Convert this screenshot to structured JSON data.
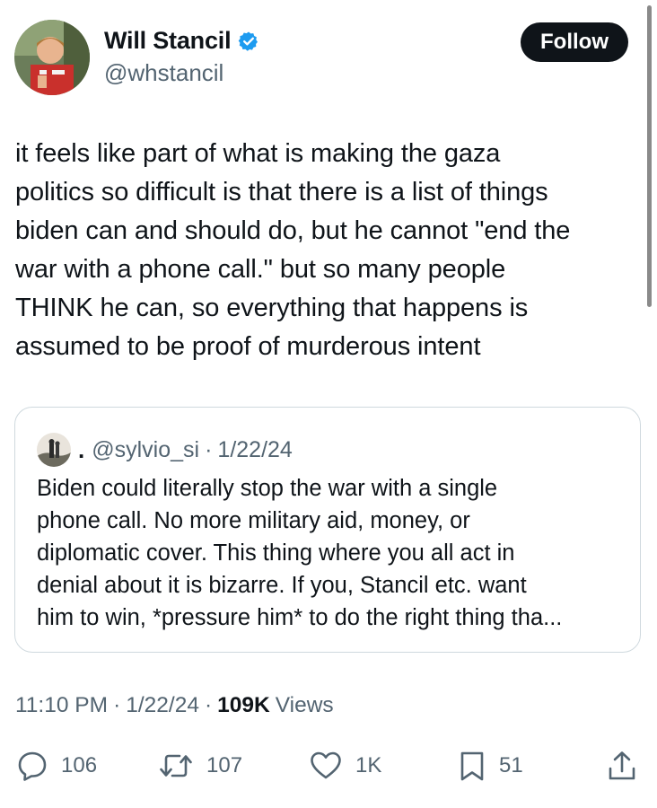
{
  "author": {
    "name": "Will Stancil",
    "handle": "@whstancil",
    "verified": true
  },
  "follow_label": "Follow",
  "tweet": {
    "lines": [
      "it feels like part of what is making the gaza",
      "politics so difficult is that there is a list of things",
      "biden can and should do, but he cannot \"end the",
      "war with a phone call.\" but so many people",
      "THINK he can, so everything that happens is",
      "assumed to be proof of murderous intent"
    ]
  },
  "quote": {
    "name": ".",
    "handle": "@sylvio_si",
    "separator": "·",
    "date": "1/22/24",
    "lines": [
      "Biden could literally stop the war with a single",
      "phone call. No more military aid, money, or",
      "diplomatic cover. This thing where you all act in",
      "denial about it is bizarre. If you, Stancil etc. want",
      "him to win, *pressure him* to do the right thing tha..."
    ]
  },
  "meta": {
    "time": "11:10 PM",
    "separator": "·",
    "date": "1/22/24",
    "views_count": "109K",
    "views_label": "Views"
  },
  "actions": {
    "replies": "106",
    "reposts": "107",
    "likes": "1K",
    "bookmarks": "51"
  },
  "colors": {
    "text": "#0f1419",
    "secondary": "#536471",
    "verified": "#1d9bf0",
    "border": "#cfd9de",
    "follow_bg": "#0f1419"
  },
  "icons": {
    "verified": "verified-badge-icon",
    "reply": "reply-icon",
    "repost": "repost-icon",
    "like": "heart-icon",
    "bookmark": "bookmark-icon",
    "share": "share-icon"
  }
}
